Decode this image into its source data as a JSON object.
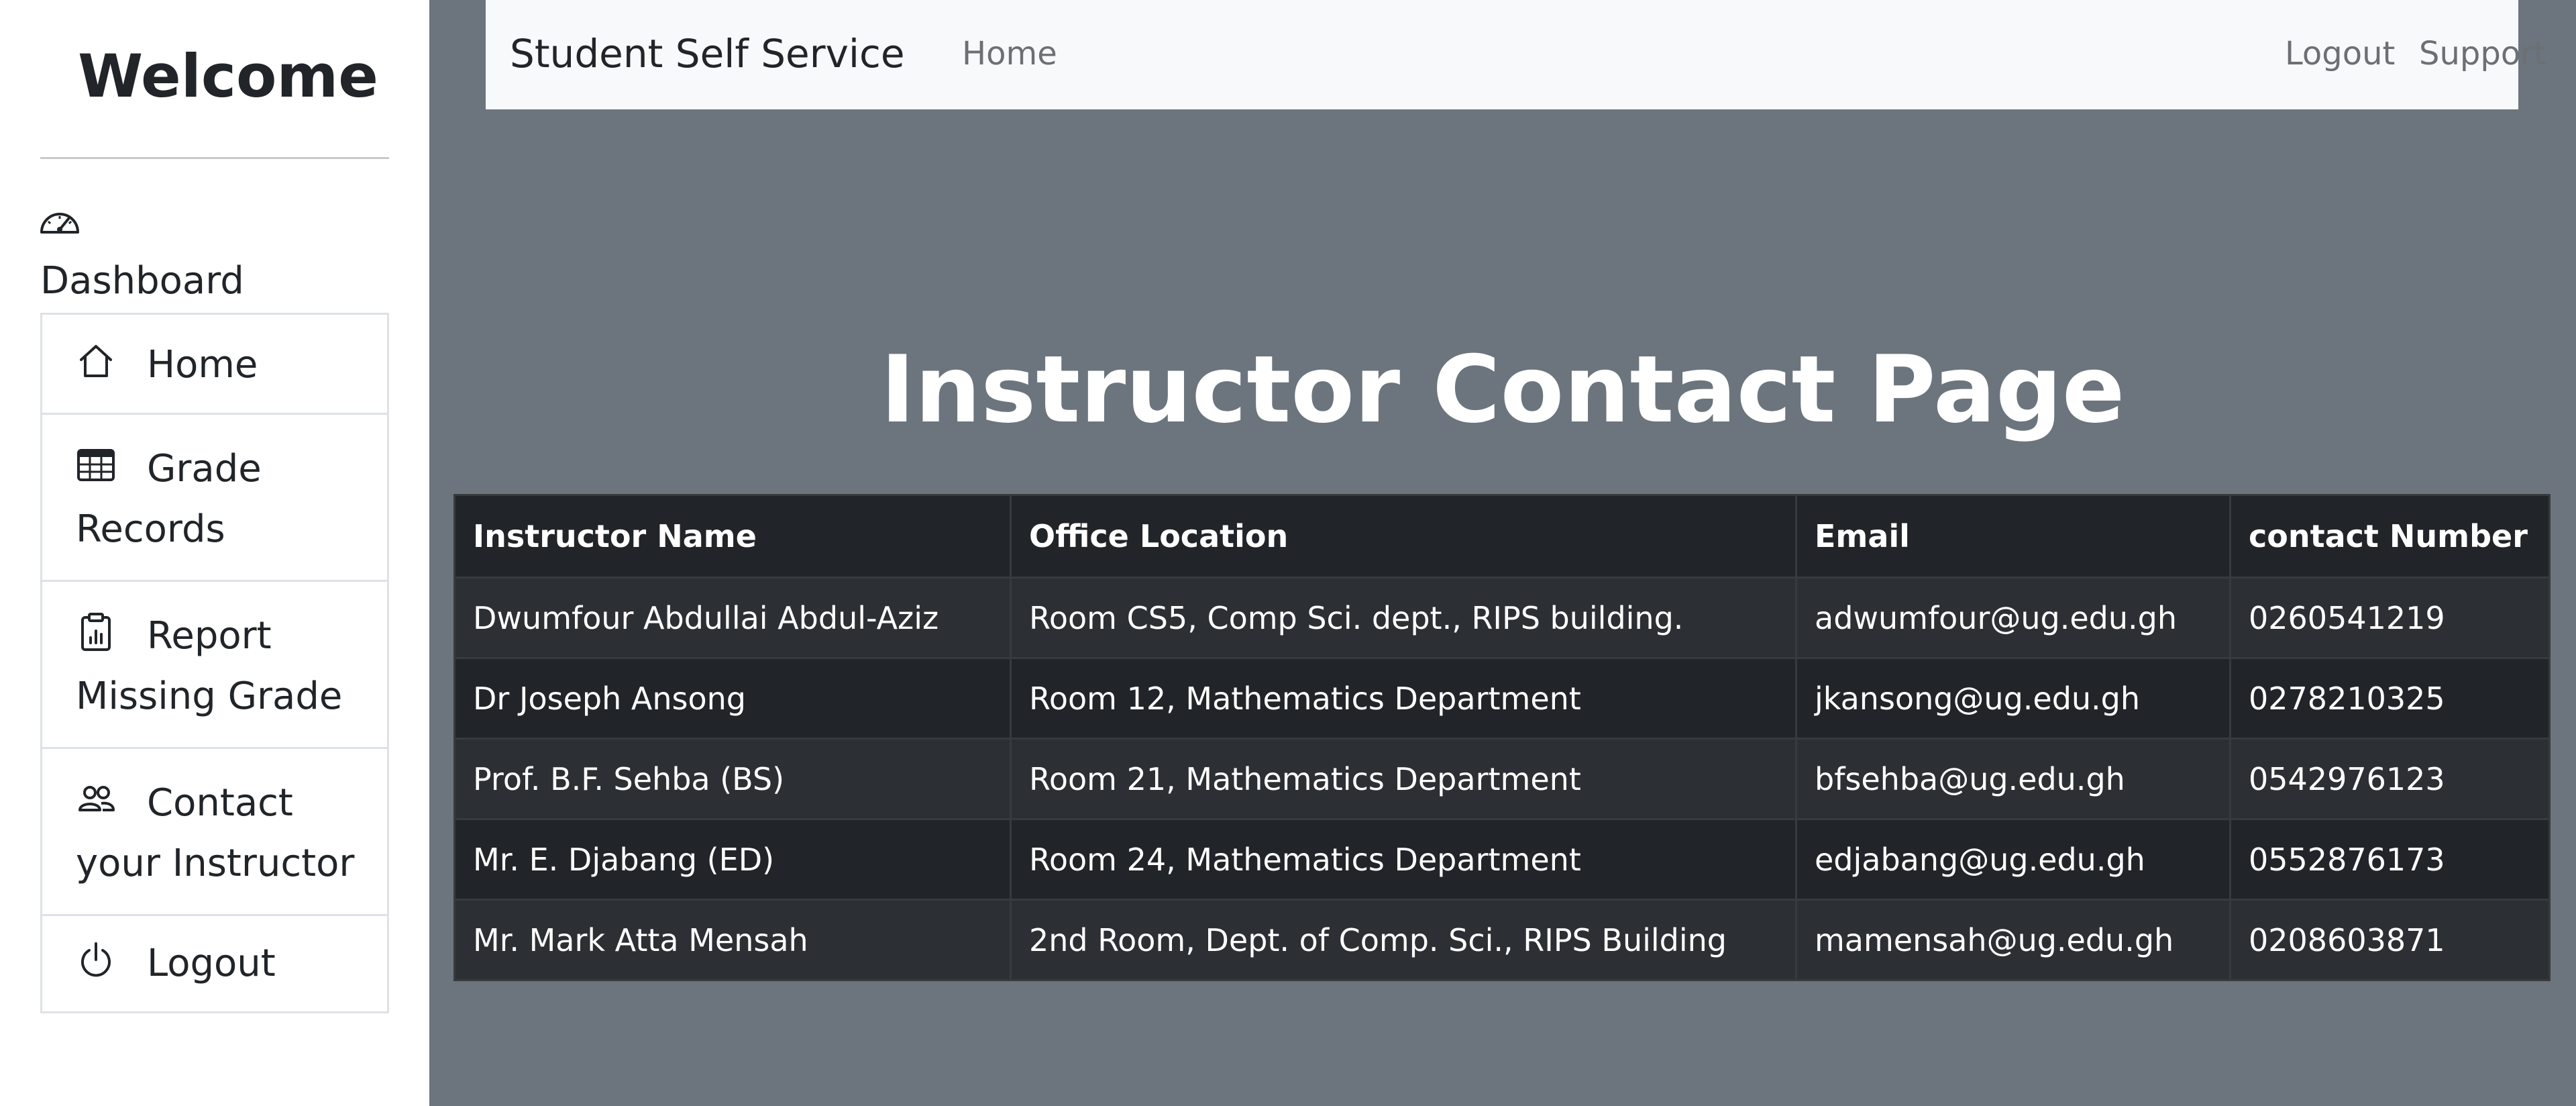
{
  "sidebar": {
    "welcome": "Welcome",
    "dashboard_label": "Dashboard",
    "dashboard_icon": "speedometer-icon",
    "items": [
      {
        "label": "Home",
        "icon": "house-icon"
      },
      {
        "label": "Grade Records",
        "icon": "table-icon"
      },
      {
        "label": "Report Missing Grade",
        "icon": "clipboard-data-icon"
      },
      {
        "label": "Contact your Instructor",
        "icon": "people-icon"
      },
      {
        "label": "Logout",
        "icon": "power-icon"
      }
    ]
  },
  "navbar": {
    "brand": "Student Self Service",
    "home": "Home",
    "logout": "Logout",
    "support": "Support"
  },
  "page": {
    "title": "Instructor Contact Page"
  },
  "table": {
    "headers": [
      "Instructor Name",
      "Office Location",
      "Email",
      "contact Number"
    ],
    "rows": [
      [
        "Dwumfour Abdullai Abdul-Aziz",
        "Room CS5, Comp Sci. dept., RIPS building.",
        "adwumfour@ug.edu.gh",
        "0260541219"
      ],
      [
        "Dr Joseph Ansong",
        "Room 12, Mathematics Department",
        "jkansong@ug.edu.gh",
        "0278210325"
      ],
      [
        "Prof. B.F. Sehba (BS)",
        "Room 21, Mathematics Department",
        "bfsehba@ug.edu.gh",
        "0542976123"
      ],
      [
        "Mr. E. Djabang (ED)",
        "Room 24, Mathematics Department",
        "edjabang@ug.edu.gh",
        "0552876173"
      ],
      [
        "Mr. Mark Atta Mensah",
        "2nd Room, Dept. of Comp. Sci., RIPS Building",
        "mamensah@ug.edu.gh",
        "0208603871"
      ]
    ]
  },
  "colors": {
    "main_bg": "#6c757d",
    "navbar_bg": "#f8f9fa",
    "table_dark": "#212529",
    "table_striped": "#2c3034"
  }
}
